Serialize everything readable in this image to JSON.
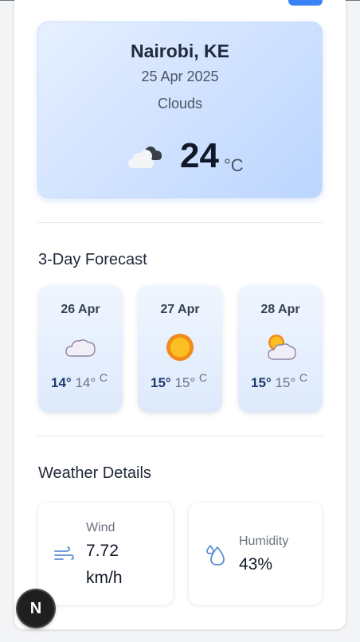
{
  "current": {
    "city": "Nairobi, KE",
    "date": "25 Apr 2025",
    "condition": "Clouds",
    "temp": "24",
    "unit": "°C",
    "icon": "clouds-icon"
  },
  "forecast": {
    "title": "3-Day Forecast",
    "days": [
      {
        "date": "26 Apr",
        "hi": "14°",
        "lo": "14°",
        "unit": "C",
        "icon": "cloud-icon"
      },
      {
        "date": "27 Apr",
        "hi": "15°",
        "lo": "15°",
        "unit": "C",
        "icon": "sun-icon"
      },
      {
        "date": "28 Apr",
        "hi": "15°",
        "lo": "15°",
        "unit": "C",
        "icon": "partly-cloudy-icon"
      }
    ]
  },
  "details": {
    "title": "Weather Details",
    "wind": {
      "label": "Wind",
      "value": "7.72",
      "unit": "km/h",
      "icon": "wind-icon"
    },
    "humidity": {
      "label": "Humidity",
      "value": "43%",
      "icon": "humidity-icon"
    }
  },
  "fab": {
    "label": "N"
  },
  "colors": {
    "accent": "#3b82f6",
    "icon_blue": "#5b8fd6",
    "sun": "#f59e0b"
  }
}
